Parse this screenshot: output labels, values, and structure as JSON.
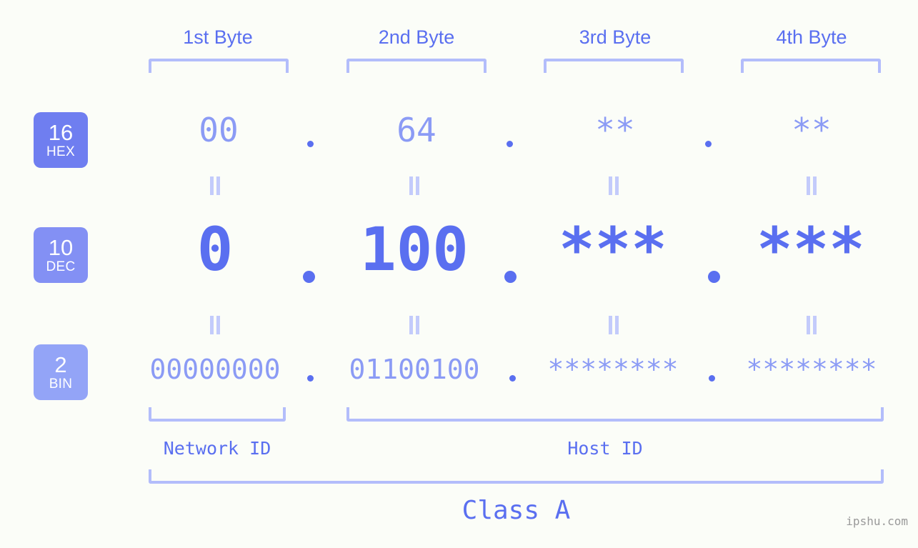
{
  "background_color": "#fbfdf8",
  "accent_color": "#5a6ff0",
  "muted_color": "#8b9bf5",
  "bracket_color": "#b3bdfb",
  "byte_headers": [
    {
      "label": "1st Byte"
    },
    {
      "label": "2nd Byte"
    },
    {
      "label": "3rd Byte"
    },
    {
      "label": "4th Byte"
    }
  ],
  "radix_rows": [
    {
      "badge_number": "16",
      "badge_name": "HEX",
      "badge_color": "#6f7ef0",
      "values": [
        "00",
        "64",
        "**",
        "**"
      ],
      "separator": "."
    },
    {
      "badge_number": "10",
      "badge_name": "DEC",
      "badge_color": "#8390f4",
      "values": [
        "0",
        "100",
        "***",
        "***"
      ],
      "separator": "."
    },
    {
      "badge_number": "2",
      "badge_name": "BIN",
      "badge_color": "#93a4f7",
      "values": [
        "00000000",
        "01100100",
        "********",
        "********"
      ],
      "separator": "."
    }
  ],
  "equality_symbol": "=",
  "sections": [
    {
      "label": "Network ID"
    },
    {
      "label": "Host ID"
    }
  ],
  "class_label": "Class A",
  "watermark": "ipshu.com"
}
